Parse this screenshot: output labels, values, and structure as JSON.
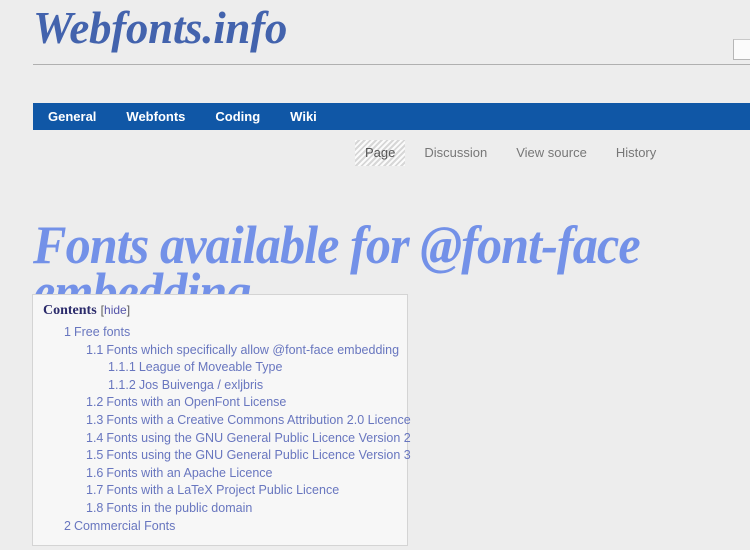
{
  "site": {
    "logo": "Webfonts.info"
  },
  "search": {
    "value": "",
    "placeholder": ""
  },
  "topnav": {
    "items": [
      {
        "label": "General"
      },
      {
        "label": "Webfonts"
      },
      {
        "label": "Coding"
      },
      {
        "label": "Wiki"
      }
    ]
  },
  "tabs": [
    {
      "label": "Page",
      "active": true
    },
    {
      "label": "Discussion",
      "active": false
    },
    {
      "label": "View source",
      "active": false
    },
    {
      "label": "History",
      "active": false
    }
  ],
  "page": {
    "title": "Fonts available for @font-face embedding"
  },
  "toc": {
    "heading": "Contents",
    "toggle_open": "[",
    "toggle_label": "hide",
    "toggle_close": "]",
    "entries": [
      {
        "level": 1,
        "number": "1",
        "label": "Free fonts"
      },
      {
        "level": 2,
        "number": "1.1",
        "label": "Fonts which specifically allow @font-face embedding"
      },
      {
        "level": 3,
        "number": "1.1.1",
        "label": "League of Moveable Type"
      },
      {
        "level": 3,
        "number": "1.1.2",
        "label": "Jos Buivenga / exljbris"
      },
      {
        "level": 2,
        "number": "1.2",
        "label": "Fonts with an OpenFont License"
      },
      {
        "level": 2,
        "number": "1.3",
        "label": "Fonts with a Creative Commons Attribution 2.0 Licence"
      },
      {
        "level": 2,
        "number": "1.4",
        "label": "Fonts using the GNU General Public Licence Version 2"
      },
      {
        "level": 2,
        "number": "1.5",
        "label": "Fonts using the GNU General Public Licence Version 3"
      },
      {
        "level": 2,
        "number": "1.6",
        "label": "Fonts with an Apache Licence"
      },
      {
        "level": 2,
        "number": "1.7",
        "label": "Fonts with a LaTeX Project Public Licence"
      },
      {
        "level": 2,
        "number": "1.8",
        "label": "Fonts in the public domain"
      },
      {
        "level": 1,
        "number": "2",
        "label": "Commercial Fonts"
      }
    ]
  },
  "colors": {
    "page_background": "#ededed",
    "nav_blue": "#1057a6",
    "logo_blue": "#4363ad",
    "title_blue": "#7391e8",
    "link_blue": "#6876bf",
    "toc_background": "#f7f7f7",
    "toc_border": "#d4d4d4"
  }
}
